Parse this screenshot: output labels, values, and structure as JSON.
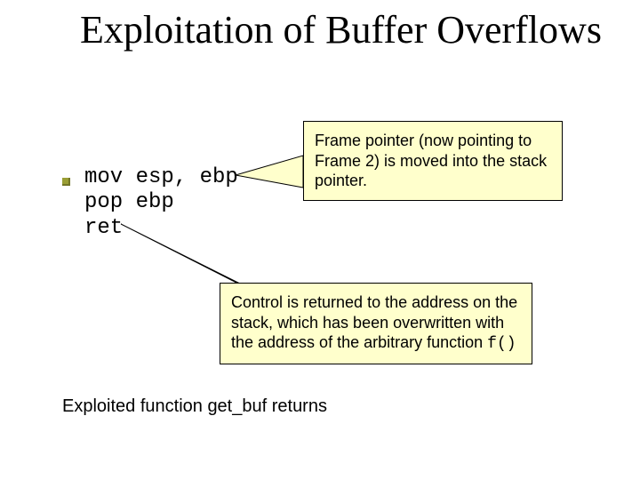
{
  "title": "Exploitation of Buffer Overflows",
  "code": {
    "line1": "mov esp, ebp",
    "line2": "pop ebp",
    "line3": "ret"
  },
  "callouts": {
    "upper": "Frame pointer (now pointing to Frame 2) is moved into the stack pointer.",
    "lower_pre": "Control is returned to the address on the stack, which has been overwritten with the address of the arbitrary function ",
    "lower_code": "f()"
  },
  "subtitle": "Exploited function get_buf returns"
}
